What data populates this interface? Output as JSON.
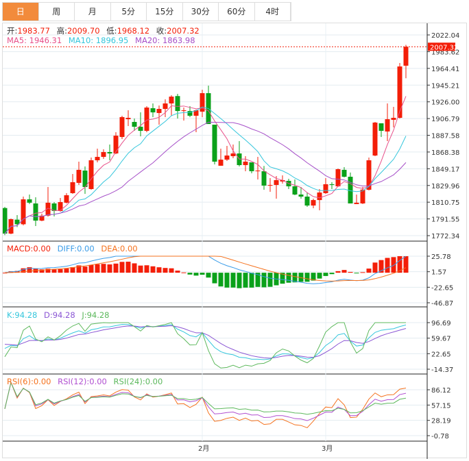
{
  "tabs": [
    "日",
    "周",
    "月",
    "5分",
    "15分",
    "30分",
    "60分",
    "4时"
  ],
  "active_tab": 0,
  "ohlc_info": {
    "open_label": "开:",
    "open": "1983.77",
    "high_label": "高:",
    "high": "2009.70",
    "low_label": "低:",
    "low": "1968.12",
    "close_label": "收:",
    "close": "2007.32"
  },
  "ma_info": {
    "ma5": "MA5: 1946.31",
    "ma10": "MA10: 1896.95",
    "ma20": "MA20: 1863.98"
  },
  "macd_info": {
    "macd": "MACD:0.00",
    "diff": "DIFF:0.00",
    "dea": "DEA:0.00"
  },
  "kdj_info": {
    "k": "K:94.28",
    "d": "D:94.28",
    "j": "J:94.28"
  },
  "rsi_info": {
    "rsi6": "RSI(6):0.00",
    "rsi12": "RSI(12):0.00",
    "rsi24": "RSI(24):0.00"
  },
  "colors": {
    "up": "#f31e08",
    "down": "#0aa11a",
    "ma5": "#e8508a",
    "ma10": "#34c6dc",
    "ma20": "#a64fc8",
    "diff": "#3a9ce8",
    "dea": "#f5721e",
    "k": "#34c6dc",
    "d": "#8a55d4",
    "j": "#5cb85c",
    "rsi6": "#f5721e",
    "rsi12": "#b04fd0",
    "rsi24": "#5cb85c",
    "tab_active": "#f28b3c"
  },
  "chart_data": {
    "type": "candlestick",
    "last_price": "2007.32",
    "price_ticks": [
      "2022.04",
      "1983.62",
      "1964.41",
      "1945.21",
      "1926.00",
      "1906.79",
      "1887.58",
      "1868.38",
      "1849.17",
      "1829.96",
      "1810.75",
      "1791.55",
      "1772.34"
    ],
    "price_ylim": [
      1772.34,
      2022.04
    ],
    "macd_ticks": [
      "25.78",
      "1.57",
      "-22.65",
      "-46.87"
    ],
    "macd_ylim": [
      -46.87,
      25.78
    ],
    "kdj_ticks": [
      "96.69",
      "59.67",
      "22.65",
      "-14.37"
    ],
    "kdj_ylim": [
      -14.37,
      96.69
    ],
    "rsi_ticks": [
      "86.12",
      "57.15",
      "28.19",
      "-0.78"
    ],
    "rsi_ylim": [
      -0.78,
      86.12
    ],
    "x_labels": [
      {
        "index": 32,
        "label": "2月"
      },
      {
        "index": 52,
        "label": "3月"
      }
    ],
    "ohlc": [
      [
        1806.7,
        1808,
        1773,
        1774.9
      ],
      [
        1774.9,
        1793.6,
        1774,
        1792.8
      ],
      [
        1792.2,
        1797.9,
        1783,
        1786.5
      ],
      [
        1786.5,
        1820.9,
        1785.1,
        1817.5
      ],
      [
        1817.5,
        1823.5,
        1811.6,
        1813.3
      ],
      [
        1812.4,
        1820.1,
        1784.3,
        1791
      ],
      [
        1791,
        1799.6,
        1790.2,
        1797.2
      ],
      [
        1797.2,
        1832.8,
        1796,
        1813.3
      ],
      [
        1812.4,
        1814.1,
        1796.2,
        1803
      ],
      [
        1803,
        1819.2,
        1802.2,
        1814.1
      ],
      [
        1813.3,
        1825.2,
        1812.4,
        1822.6
      ],
      [
        1825.2,
        1849,
        1824.3,
        1838.8
      ],
      [
        1838,
        1864.4,
        1835.4,
        1854.2
      ],
      [
        1853.3,
        1858.4,
        1824.3,
        1832.8
      ],
      [
        1830.3,
        1869.5,
        1829.4,
        1866.1
      ],
      [
        1866.1,
        1880.6,
        1863.5,
        1870.3
      ],
      [
        1870.3,
        1879.7,
        1867.8,
        1876.3
      ],
      [
        1876.3,
        1885.7,
        1866.1,
        1874.6
      ],
      [
        1874.6,
        1901,
        1873.7,
        1896.7
      ],
      [
        1895.1,
        1921.5,
        1892.5,
        1919.8
      ],
      [
        1917.2,
        1928.3,
        1908.7,
        1918.9
      ],
      [
        1913.8,
        1918.1,
        1902.7,
        1907.8
      ],
      [
        1907.8,
        1925.7,
        1895.9,
        1902.7
      ],
      [
        1902.7,
        1933.4,
        1901,
        1931.7
      ],
      [
        1930.9,
        1936.8,
        1919.8,
        1925.7
      ],
      [
        1924.9,
        1934.3,
        1910.4,
        1930
      ],
      [
        1930,
        1941.9,
        1919.8,
        1936.8
      ],
      [
        1936.8,
        1947,
        1921.5,
        1945.3
      ],
      [
        1946,
        1948.8,
        1918.1,
        1927.4
      ],
      [
        1927.4,
        1931.7,
        1915.5,
        1928.3
      ],
      [
        1927.4,
        1933.4,
        1919.8,
        1921.5
      ],
      [
        1921.5,
        1929.2,
        1901,
        1928.3
      ],
      [
        1926.6,
        1953.9,
        1919.8,
        1949.6
      ],
      [
        1949.6,
        1959,
        1911.2,
        1911.2
      ],
      [
        1910.4,
        1910.4,
        1861,
        1864.4
      ],
      [
        1859.3,
        1880.6,
        1859.3,
        1866.9
      ],
      [
        1866.9,
        1884,
        1865.2,
        1872
      ],
      [
        1871.2,
        1885.7,
        1868.6,
        1874.6
      ],
      [
        1874.6,
        1889.9,
        1858.4,
        1860.1
      ],
      [
        1860.1,
        1871.2,
        1852.5,
        1864.4
      ],
      [
        1863.5,
        1863.5,
        1849.9,
        1852.5
      ],
      [
        1852.5,
        1870.3,
        1842.2,
        1853.3
      ],
      [
        1852.5,
        1859,
        1829.4,
        1834.6
      ],
      [
        1834.6,
        1843.9,
        1826.9,
        1835.4
      ],
      [
        1835.4,
        1846.5,
        1818.4,
        1841.4
      ],
      [
        1839.7,
        1847.3,
        1837.1,
        1841.4
      ],
      [
        1840.5,
        1843.1,
        1830.3,
        1833.7
      ],
      [
        1833.7,
        1842.2,
        1822.6,
        1823.5
      ],
      [
        1823.5,
        1832.8,
        1818.4,
        1820.9
      ],
      [
        1820.9,
        1826,
        1808.1,
        1809.8
      ],
      [
        1809.8,
        1818.4,
        1806.4,
        1816.6
      ],
      [
        1816.6,
        1830.3,
        1803.9,
        1826
      ],
      [
        1825.2,
        1843.9,
        1824.3,
        1836.3
      ],
      [
        1836.3,
        1838.8,
        1830.3,
        1835.4
      ],
      [
        1833.7,
        1855.9,
        1832.8,
        1855
      ],
      [
        1854.2,
        1857.6,
        1844.8,
        1845.6
      ],
      [
        1845.6,
        1850.8,
        1812.4,
        1812.4
      ],
      [
        1811.6,
        1823.5,
        1811.6,
        1813.3
      ],
      [
        1812.4,
        1832.8,
        1811.6,
        1829.6
      ],
      [
        1829.4,
        1869.5,
        1828.6,
        1866.1
      ],
      [
        1872,
        1913.8,
        1871.2,
        1913
      ],
      [
        1912.1,
        1912.1,
        1895.1,
        1902.7
      ],
      [
        1901.9,
        1936.8,
        1889.9,
        1917.2
      ],
      [
        1916.4,
        1932.6,
        1907,
        1918.9
      ],
      [
        1918.9,
        1987.1,
        1918.1,
        1982.8
      ],
      [
        1983.77,
        2009.7,
        1968.12,
        2007.32
      ]
    ]
  }
}
